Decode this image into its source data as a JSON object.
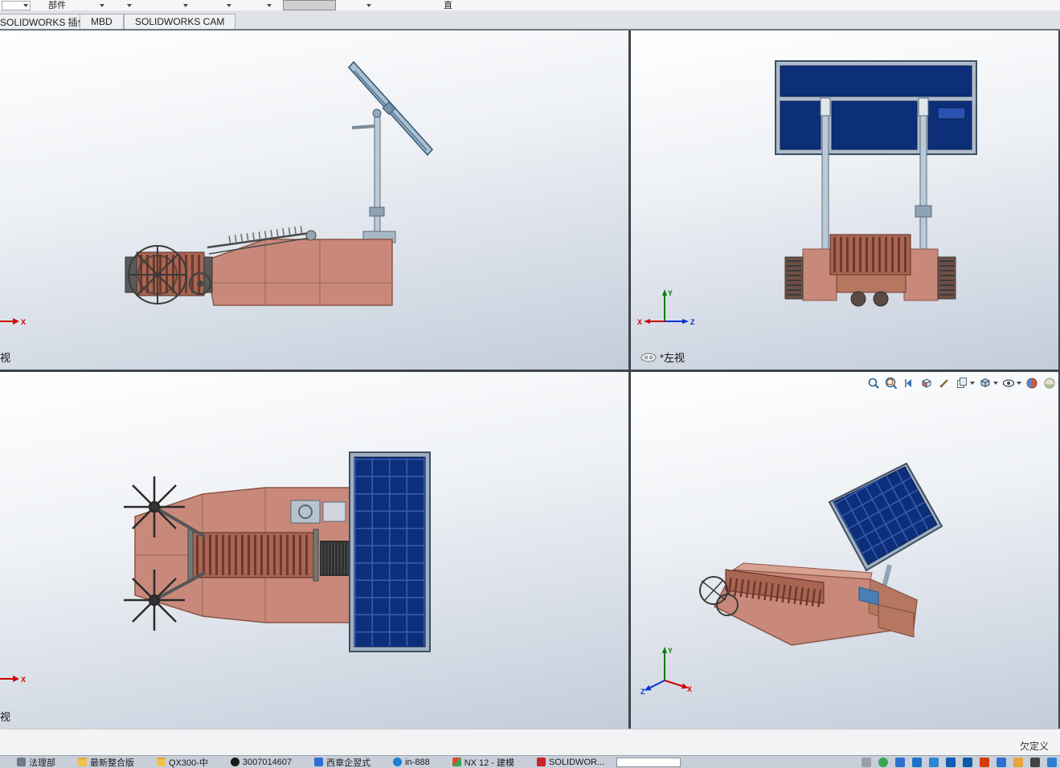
{
  "toolbar": {
    "assembly_label": "部件",
    "glyph_button": "直"
  },
  "tabs": [
    "SOLIDWORKS 插件",
    "MBD",
    "SOLIDWORKS CAM"
  ],
  "viewports": {
    "top_left": {
      "label": "视"
    },
    "top_right": {
      "label": "*左视"
    },
    "bottom_left": {
      "label": "视"
    },
    "bottom_right": {
      "label": ""
    }
  },
  "triad": {
    "x": "X",
    "y": "Y",
    "z": "Z"
  },
  "hud_icons": [
    "zoom-to-fit",
    "zoom-to-area",
    "previous-view",
    "section-view",
    "annotation",
    "annotation-views",
    "display-style",
    "hide-show-items",
    "edit-appearance",
    "apply-scene"
  ],
  "status_bar": {
    "status_text": "欠定义"
  },
  "taskbar": {
    "items": [
      {
        "label": "法理部",
        "icon": "app-icon"
      },
      {
        "label": "最新整合版",
        "icon": "folder-icon"
      },
      {
        "label": "QX300-中",
        "icon": "folder-icon"
      },
      {
        "label": "3007014607",
        "icon": "qq-icon"
      },
      {
        "label": "西章企翌式",
        "icon": "document-icon"
      },
      {
        "label": "in-888",
        "icon": "browser-icon"
      },
      {
        "label": "NX 12 - 建模",
        "icon": "nx-icon"
      },
      {
        "label": "SOLIDWOR...",
        "icon": "solidworks-icon"
      }
    ],
    "search": {
      "value": "",
      "placeholder": ""
    }
  },
  "colors": {
    "viewport_gradient_top": "#ffffff",
    "viewport_gradient_bottom": "#c3ccda",
    "machine_body": "#c9897a",
    "solar_panel": "#0d2f7a",
    "panel_frame": "#9fb0bf",
    "axis_x": "#cc0000",
    "axis_y": "#007f00",
    "axis_z": "#0033cc"
  }
}
